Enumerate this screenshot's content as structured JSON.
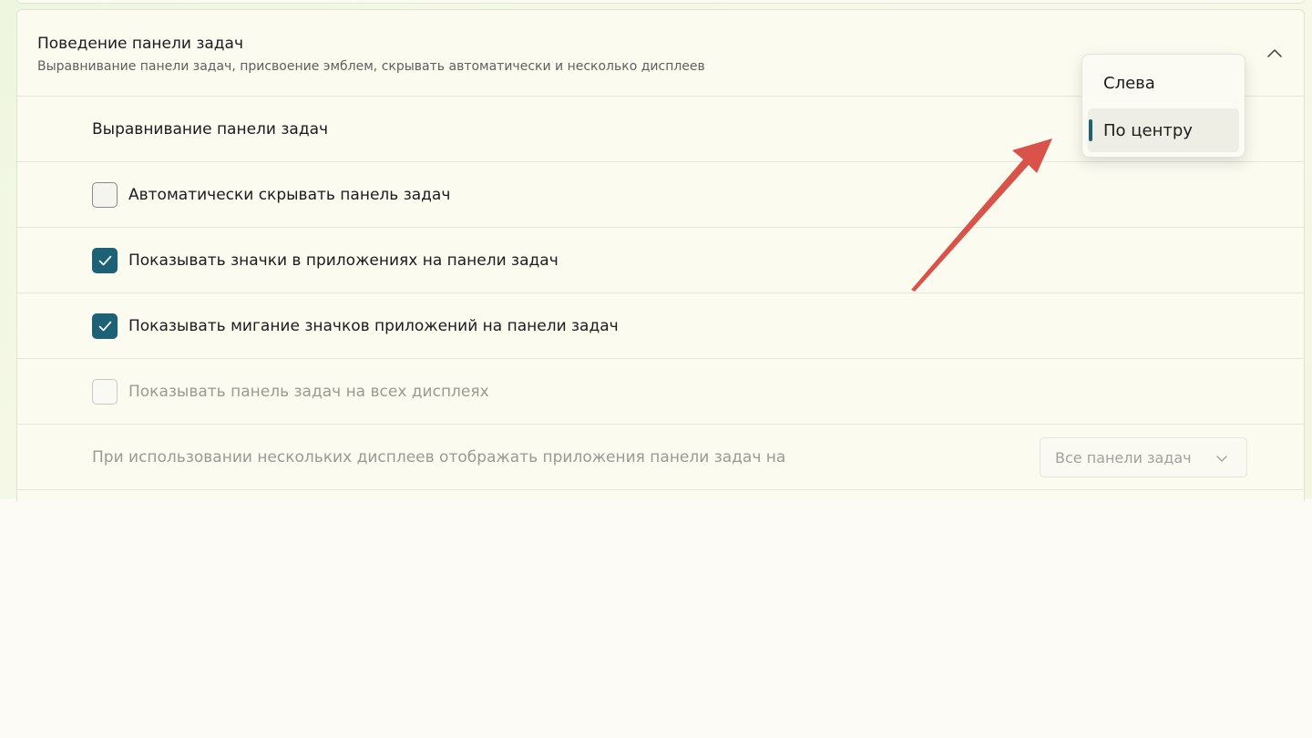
{
  "colors": {
    "accent": "#1d6176",
    "annotation_arrow": "#d9534a"
  },
  "taskbar_behaviors": {
    "title": "Поведение панели задач",
    "subtitle": "Выравнивание панели задач, присвоение эмблем, скрывать автоматически и несколько дисплеев",
    "collapse_icon": "chevron-up-icon",
    "alignment": {
      "label": "Выравнивание панели задач",
      "options": [
        {
          "label": "Слева",
          "selected": false
        },
        {
          "label": "По центру",
          "selected": true
        }
      ]
    },
    "checkboxes": [
      {
        "label": "Автоматически скрывать панель задач",
        "checked": false,
        "enabled": true
      },
      {
        "label": "Показывать значки в приложениях на панели задач",
        "checked": true,
        "enabled": true
      },
      {
        "label": "Показывать мигание значков приложений на панели задач",
        "checked": true,
        "enabled": true
      },
      {
        "label": "Показывать панель задач на всех дисплеях",
        "checked": false,
        "enabled": false
      }
    ],
    "multi_display": {
      "label": "При использовании нескольких дисплеев отображать приложения панели задач на",
      "value": "Все панели задач",
      "enabled": false
    }
  }
}
